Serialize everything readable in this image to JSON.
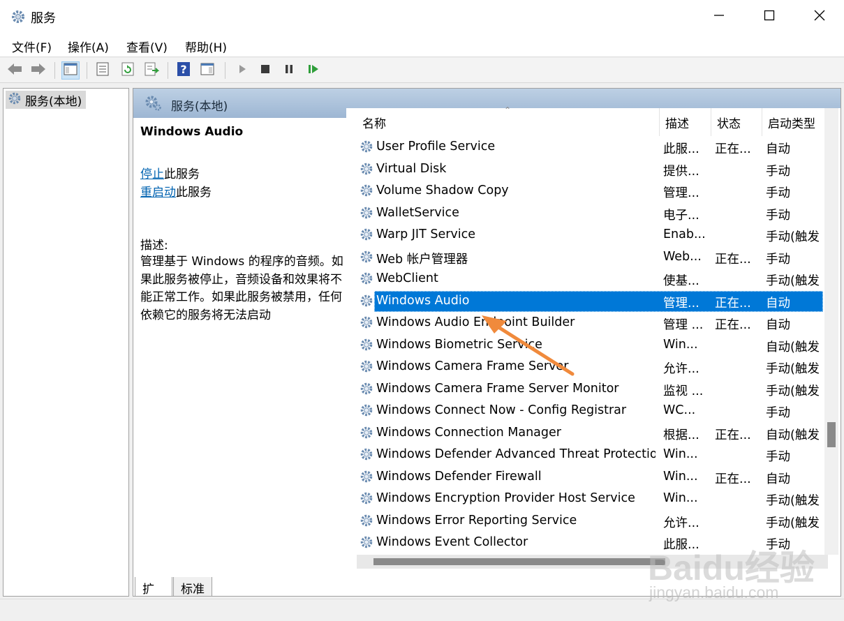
{
  "window": {
    "title": "服务"
  },
  "menu": [
    "文件(F)",
    "操作(A)",
    "查看(V)",
    "帮助(H)"
  ],
  "tree": {
    "item": "服务(本地)"
  },
  "panel": {
    "header": "服务(本地)",
    "selected_name": "Windows Audio",
    "stop_link": "停止",
    "stop_suffix": "此服务",
    "restart_link": "重启动",
    "restart_suffix": "此服务",
    "desc_label": "描述:",
    "desc_text": "管理基于 Windows 的程序的音频。如果此服务被停止，音频设备和效果将不能正常工作。如果此服务被禁用，任何依赖它的服务将无法启动"
  },
  "columns": [
    "名称",
    "描述",
    "状态",
    "启动类型"
  ],
  "rows": [
    {
      "name": "User Profile Service",
      "desc": "此服...",
      "status": "正在...",
      "startup": "自动"
    },
    {
      "name": "Virtual Disk",
      "desc": "提供...",
      "status": "",
      "startup": "手动"
    },
    {
      "name": "Volume Shadow Copy",
      "desc": "管理...",
      "status": "",
      "startup": "手动"
    },
    {
      "name": "WalletService",
      "desc": "电子...",
      "status": "",
      "startup": "手动"
    },
    {
      "name": "Warp JIT Service",
      "desc": "Enab...",
      "status": "",
      "startup": "手动(触发"
    },
    {
      "name": "Web 帐户管理器",
      "desc": "Web...",
      "status": "正在...",
      "startup": "手动"
    },
    {
      "name": "WebClient",
      "desc": "使基...",
      "status": "",
      "startup": "手动(触发"
    },
    {
      "name": "Windows Audio",
      "desc": "管理...",
      "status": "正在...",
      "startup": "自动",
      "selected": true
    },
    {
      "name": "Windows Audio Endpoint Builder",
      "desc": "管理 ...",
      "status": "正在...",
      "startup": "自动"
    },
    {
      "name": "Windows Biometric Service",
      "desc": "Win...",
      "status": "",
      "startup": "自动(触发"
    },
    {
      "name": "Windows Camera Frame Server",
      "desc": "允许...",
      "status": "",
      "startup": "手动(触发"
    },
    {
      "name": "Windows Camera Frame Server Monitor",
      "desc": "监视 ...",
      "status": "",
      "startup": "手动(触发"
    },
    {
      "name": "Windows Connect Now - Config Registrar",
      "desc": "WC...",
      "status": "",
      "startup": "手动"
    },
    {
      "name": "Windows Connection Manager",
      "desc": "根据...",
      "status": "正在...",
      "startup": "自动(触发"
    },
    {
      "name": "Windows Defender Advanced Threat Protectio...",
      "desc": "Win...",
      "status": "",
      "startup": "手动"
    },
    {
      "name": "Windows Defender Firewall",
      "desc": "Win...",
      "status": "正在...",
      "startup": "自动"
    },
    {
      "name": "Windows Encryption Provider Host Service",
      "desc": "Win...",
      "status": "",
      "startup": "手动(触发"
    },
    {
      "name": "Windows Error Reporting Service",
      "desc": "允许...",
      "status": "",
      "startup": "手动(触发"
    },
    {
      "name": "Windows Event Collector",
      "desc": "此服...",
      "status": "",
      "startup": "手动"
    }
  ],
  "tabs": [
    "扩展",
    "标准"
  ],
  "watermark": {
    "logo": "Baidu经验",
    "url": "jingyan.baidu.com"
  },
  "colors": {
    "selection": "#0078d7",
    "header_band": "#a9c0d9",
    "link": "#0063b1",
    "annotation_arrow": "#f08a3c"
  }
}
